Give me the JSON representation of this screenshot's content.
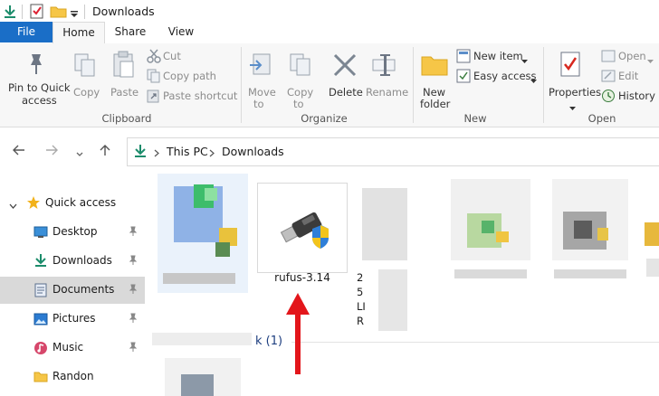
{
  "window": {
    "title": "Downloads"
  },
  "tabs": {
    "file": "File",
    "home": "Home",
    "share": "Share",
    "view": "View"
  },
  "ribbon": {
    "clipboard": {
      "pin_label": "Pin to Quick access",
      "pin_line1": "Pin to Quick",
      "pin_line2": "access",
      "copy": "Copy",
      "paste": "Paste",
      "cut": "Cut",
      "copy_path": "Copy path",
      "paste_shortcut": "Paste shortcut",
      "title": "Clipboard"
    },
    "organize": {
      "move_to": "Move to",
      "move_line1": "Move",
      "move_line2": "to",
      "copy_to": "Copy to",
      "copy_line1": "Copy",
      "copy_line2": "to",
      "delete": "Delete",
      "rename": "Rename",
      "title": "Organize"
    },
    "new": {
      "new_folder_line1": "New",
      "new_folder_line2": "folder",
      "new_item": "New item",
      "easy_access": "Easy access",
      "title": "New"
    },
    "open": {
      "properties": "Properties",
      "open": "Open",
      "edit": "Edit",
      "history": "History",
      "title": "Open"
    }
  },
  "address": {
    "segments": [
      "This PC",
      "Downloads"
    ]
  },
  "sidebar": {
    "items": [
      {
        "label": "Quick access",
        "icon": "star-icon"
      },
      {
        "label": "Desktop",
        "icon": "desktop-icon",
        "pinned": true
      },
      {
        "label": "Downloads",
        "icon": "download-icon",
        "pinned": true
      },
      {
        "label": "Documents",
        "icon": "documents-icon",
        "pinned": true,
        "selected": true
      },
      {
        "label": "Pictures",
        "icon": "pictures-icon",
        "pinned": true
      },
      {
        "label": "Music",
        "icon": "music-icon",
        "pinned": true
      },
      {
        "label": "Randon",
        "icon": "folder-icon"
      }
    ]
  },
  "files": {
    "rufus_label": "rufus-3.14",
    "partial_texts": [
      "2",
      "5",
      "LI",
      "R"
    ],
    "group_count": "k (1)"
  },
  "colors": {
    "accent": "#1a6ec7",
    "arrow": "#e3161b"
  }
}
